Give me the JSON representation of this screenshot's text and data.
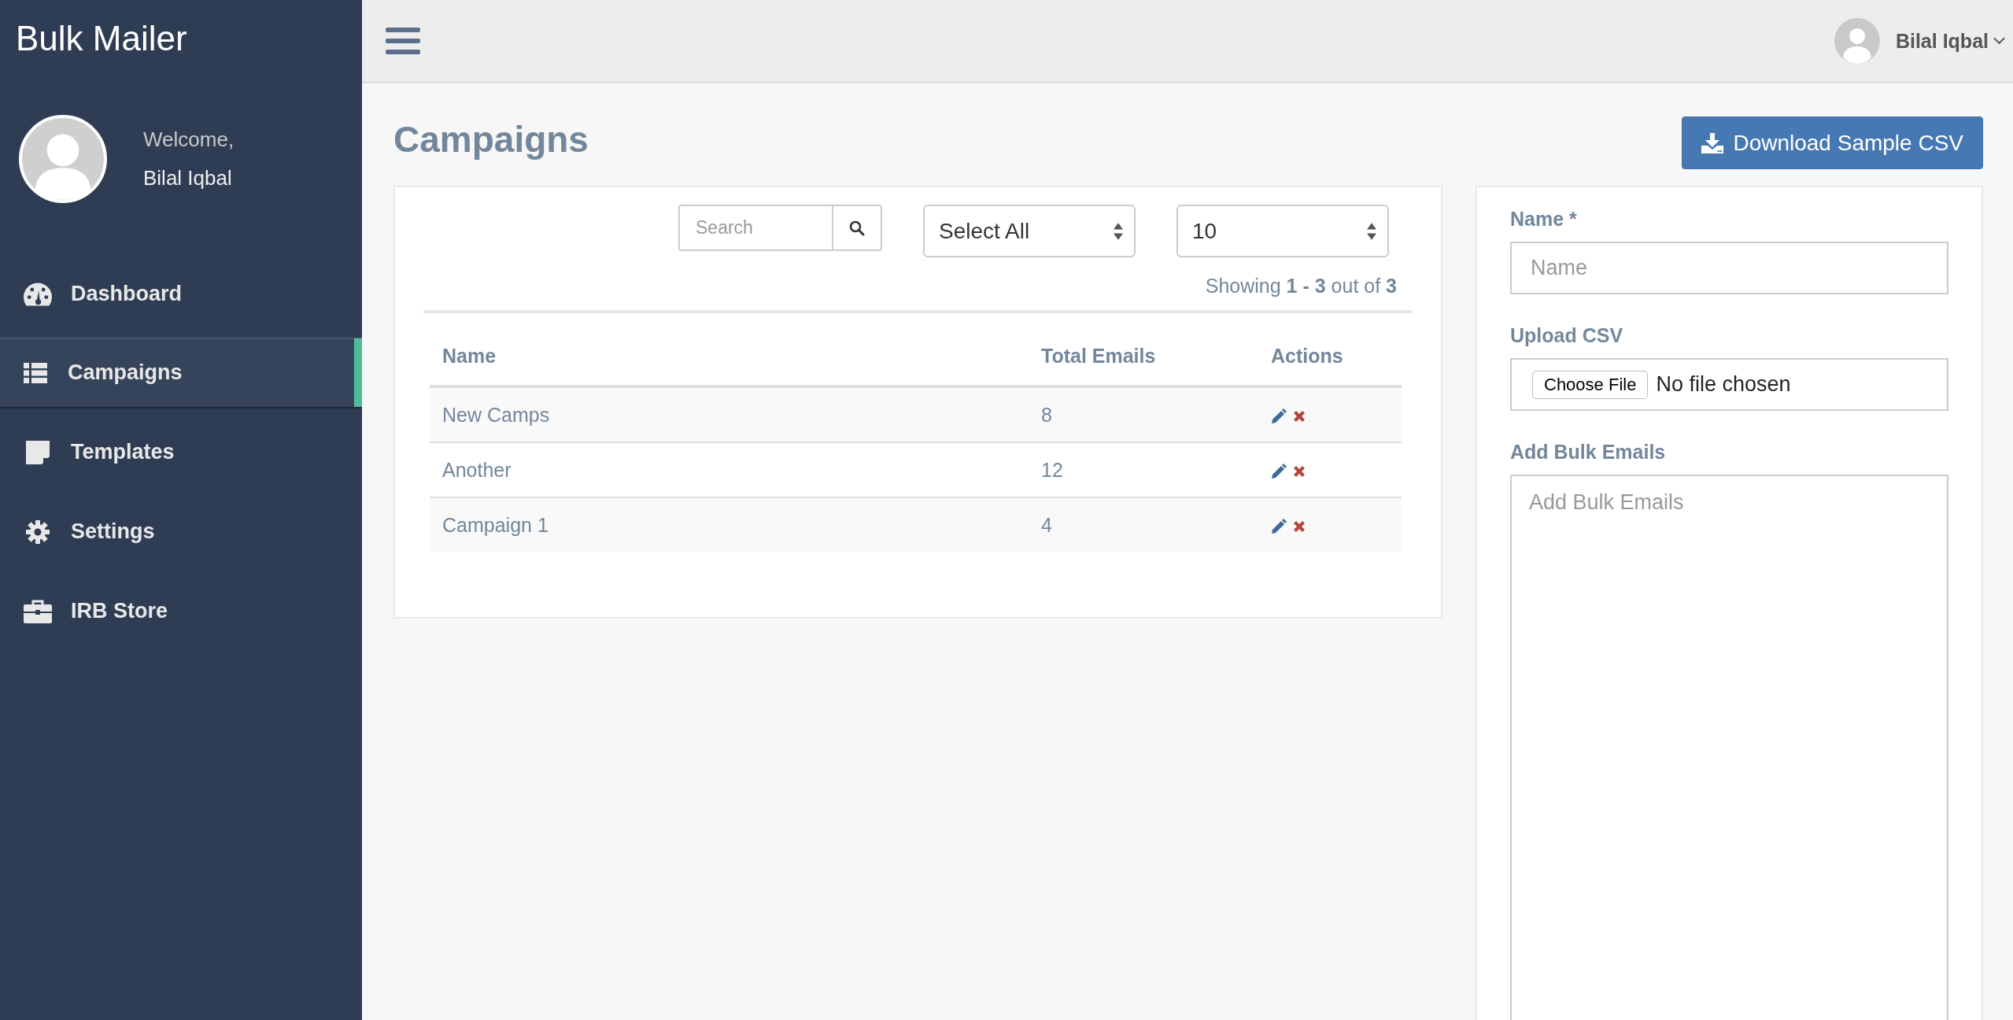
{
  "app": {
    "title": "Bulk Mailer"
  },
  "profile": {
    "greeting": "Welcome,",
    "name": "Bilal Iqbal"
  },
  "nav": [
    {
      "label": "Dashboard",
      "selected": false
    },
    {
      "label": "Campaigns",
      "selected": true
    },
    {
      "label": "Templates",
      "selected": false
    },
    {
      "label": "Settings",
      "selected": false
    },
    {
      "label": "IRB Store",
      "selected": false
    }
  ],
  "topbar": {
    "user_name": "Bilal Iqbal"
  },
  "page": {
    "title": "Campaigns",
    "download_button": "Download Sample CSV"
  },
  "campaigns": {
    "search": {
      "placeholder": "Search"
    },
    "filter_select": {
      "value": "Select All"
    },
    "page_size_select": {
      "value": "10"
    },
    "summary": "Showing **1 - 3** out of **3**",
    "columns": [
      "Name",
      "Total Emails",
      "Actions"
    ],
    "rows": [
      {
        "name": "New Camps",
        "total_emails": "8"
      },
      {
        "name": "Another",
        "total_emails": "12"
      },
      {
        "name": "Campaign 1",
        "total_emails": "4"
      }
    ]
  },
  "form": {
    "name_label": "Name *",
    "name_field": {
      "placeholder": "Name"
    },
    "upload_label": "Upload CSV",
    "file_button": "Choose File",
    "file_status": "No file chosen",
    "emails_label": "Add Bulk Emails",
    "emails_field": {
      "placeholder": "Add Bulk Emails"
    }
  }
}
